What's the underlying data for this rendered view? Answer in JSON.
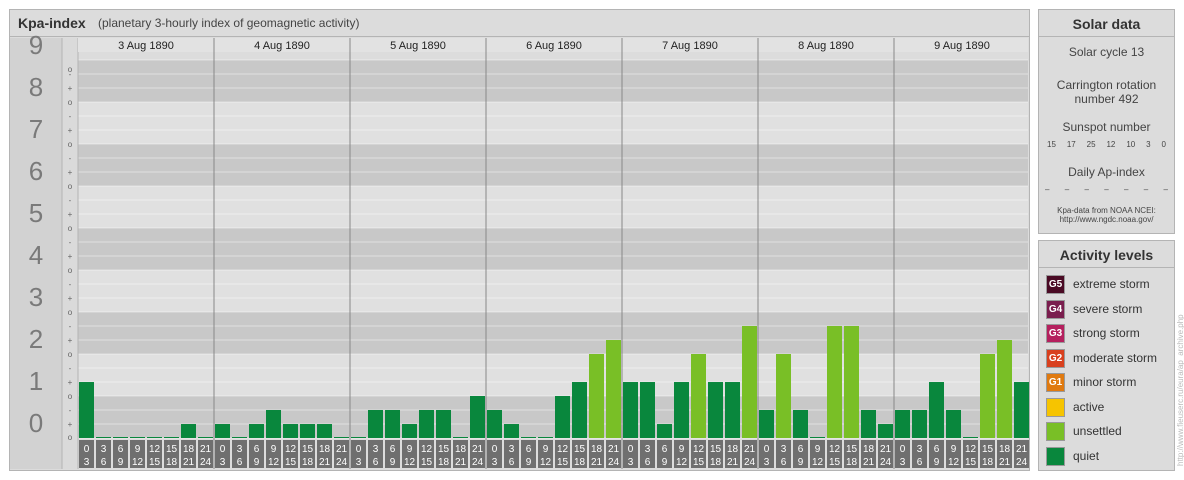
{
  "title": {
    "main": "Kpa-index",
    "sub": "(planetary 3-hourly index of geomagnetic activity)"
  },
  "colors": {
    "quiet": "#09873d",
    "unsettled": "#79bf26",
    "active": "#f6c400",
    "minor": "#e07a10",
    "moderate": "#d9401e",
    "strong": "#b5205e",
    "severe": "#7a1e4e",
    "extreme": "#4a0a24"
  },
  "chart_data": {
    "type": "bar",
    "title": "Kpa-index",
    "ylim": [
      0,
      9
    ],
    "y_major_ticks": [
      "0",
      "1",
      "2",
      "3",
      "4",
      "5",
      "6",
      "7",
      "8",
      "9"
    ],
    "y_minor_ticks": [
      "o",
      "+",
      "-"
    ],
    "days": [
      "3 Aug 1890",
      "4 Aug 1890",
      "5 Aug 1890",
      "6 Aug 1890",
      "7 Aug 1890",
      "8 Aug 1890",
      "9 Aug 1890"
    ],
    "interval_starts": [
      "0",
      "3",
      "6",
      "9",
      "12",
      "15",
      "18",
      "21"
    ],
    "interval_ends": [
      "3",
      "6",
      "9",
      "12",
      "15",
      "18",
      "21",
      "24"
    ],
    "values": [
      [
        1.333,
        0,
        0,
        0,
        0,
        0,
        0.333,
        0
      ],
      [
        0.333,
        0,
        0.333,
        0.667,
        0.333,
        0.333,
        0.333,
        0
      ],
      [
        0,
        0.667,
        0.667,
        0.333,
        0.667,
        0.667,
        0,
        1
      ],
      [
        0.667,
        0.333,
        0,
        0,
        1,
        1.333,
        2,
        2.333
      ],
      [
        1.333,
        1.333,
        0.333,
        1.333,
        2,
        1.333,
        1.333,
        2.667
      ],
      [
        0.667,
        2,
        0.667,
        0,
        2.667,
        2.667,
        0.667,
        0.333
      ],
      [
        0.667,
        0.667,
        1.333,
        0.667,
        0,
        2,
        2.333,
        1.333
      ]
    ]
  },
  "solar": {
    "title": "Solar data",
    "cycle": "Solar cycle 13",
    "carrington_1": "Carrington rotation",
    "carrington_2": "number 492",
    "sunspot_title": "Sunspot number",
    "sunspots": [
      "15",
      "17",
      "25",
      "12",
      "10",
      "3",
      "0"
    ],
    "ap_title": "Daily Ap-index",
    "ap_values": [
      "–",
      "–",
      "–",
      "–",
      "–",
      "–",
      "–"
    ],
    "source_1": "Kpa-data from NOAA NCEI:",
    "source_2": "http://www.ngdc.noaa.gov/"
  },
  "levels": {
    "title": "Activity levels",
    "items": [
      {
        "code": "G5",
        "label": "extreme storm",
        "color": "#4a0a24"
      },
      {
        "code": "G4",
        "label": "severe storm",
        "color": "#7a1e4e"
      },
      {
        "code": "G3",
        "label": "strong storm",
        "color": "#b5205e"
      },
      {
        "code": "G2",
        "label": "moderate storm",
        "color": "#d9401e"
      },
      {
        "code": "G1",
        "label": "minor storm",
        "color": "#e07a10"
      },
      {
        "code": "",
        "label": "active",
        "color": "#f6c400"
      },
      {
        "code": "",
        "label": "unsettled",
        "color": "#79bf26"
      },
      {
        "code": "",
        "label": "quiet",
        "color": "#09873d"
      }
    ]
  },
  "watermark": "http://www.fieuserc.ru/eura/ap_archive.php"
}
